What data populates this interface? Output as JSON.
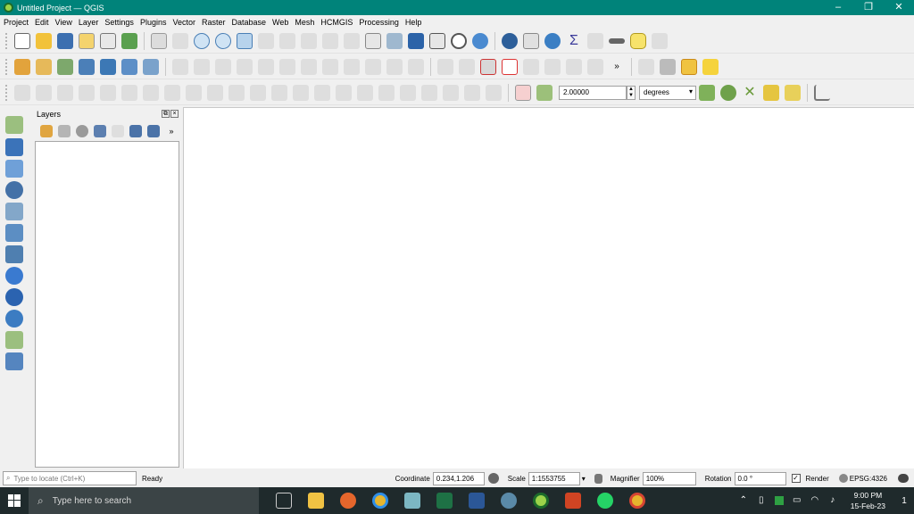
{
  "window": {
    "title": "Untitled Project — QGIS",
    "controls": [
      "–",
      "❐",
      "✕"
    ]
  },
  "menu": [
    "Project",
    "Edit",
    "View",
    "Layer",
    "Settings",
    "Plugins",
    "Vector",
    "Raster",
    "Database",
    "Web",
    "Mesh",
    "HCMGIS",
    "Processing",
    "Help"
  ],
  "snapping": {
    "tolerance": "2.00000",
    "unit": "degrees"
  },
  "layers_panel": {
    "title": "Layers"
  },
  "statusbar": {
    "locate_placeholder": "Type to locate (Ctrl+K)",
    "status": "Ready",
    "coordinate_label": "Coordinate",
    "coordinate_value": "0.234,1.206",
    "scale_label": "Scale",
    "scale_value": "1:1553755",
    "magnifier_label": "Magnifier",
    "magnifier_value": "100%",
    "rotation_label": "Rotation",
    "rotation_value": "0.0 °",
    "render_label": "Render",
    "crs": "EPSG:4326"
  },
  "taskbar": {
    "search_placeholder": "Type here to search",
    "time": "9:00 PM",
    "date": "15-Feb-23",
    "notifications": "1"
  },
  "colors": {
    "titlebar": "#00837a",
    "taskbar": "#1f2a2c",
    "accent_green": "#9cd34a"
  }
}
